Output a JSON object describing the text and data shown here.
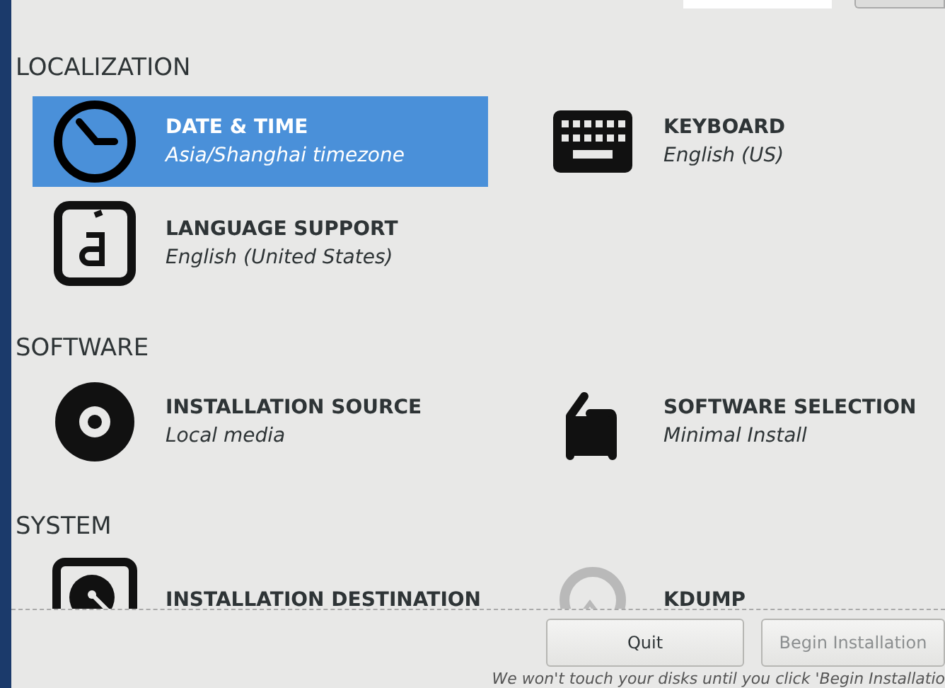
{
  "sections": [
    {
      "title": "LOCALIZATION",
      "items": [
        {
          "kind": "clock",
          "title": "DATE & TIME",
          "status": "Asia/Shanghai timezone",
          "selected": true
        },
        {
          "kind": "keyboard",
          "title": "KEYBOARD",
          "status": "English (US)",
          "selected": false
        },
        {
          "kind": "language",
          "title": "LANGUAGE SUPPORT",
          "status": "English (United States)",
          "selected": false
        }
      ]
    },
    {
      "title": "SOFTWARE",
      "items": [
        {
          "kind": "disc",
          "title": "INSTALLATION SOURCE",
          "status": "Local media",
          "selected": false
        },
        {
          "kind": "package",
          "title": "SOFTWARE SELECTION",
          "status": "Minimal Install",
          "selected": false
        }
      ]
    },
    {
      "title": "SYSTEM",
      "items": [
        {
          "kind": "drive",
          "title": "INSTALLATION DESTINATION",
          "selected": false
        },
        {
          "kind": "kdump",
          "title": "KDUMP",
          "selected": false
        }
      ]
    }
  ],
  "buttons": [
    {
      "label": "Quit",
      "disabled": false
    },
    {
      "label": "Begin Installation",
      "disabled": true
    }
  ],
  "footer_note": "We won't touch your disks until you click 'Begin Installatio"
}
